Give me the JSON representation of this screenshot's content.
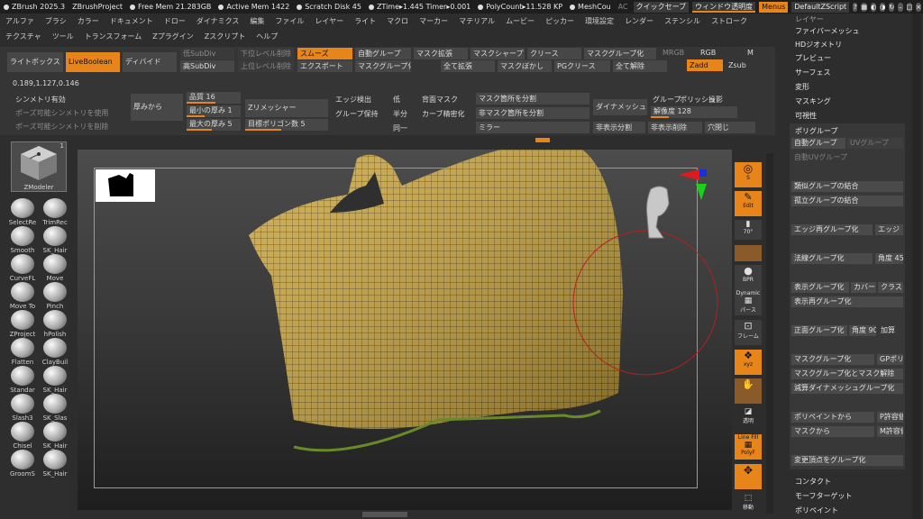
{
  "topbar": {
    "app": "ZBrush 2025.3",
    "project": "ZBrushProject",
    "free_mem": "Free Mem 21.283GB",
    "active_mem": "Active Mem 1422",
    "scratch": "Scratch Disk 45",
    "ztime": "ZTime▸1.445 Timer▸0.001",
    "polycount": "PolyCount▸11.528 KP",
    "meshcount": "MeshCou",
    "ac": "AC",
    "quicksave": "クイックセーブ",
    "window_transparency": "ウィンドウ透明度",
    "menus": "Menus",
    "default_script": "DefaultZScript"
  },
  "menus_row1": [
    "アルファ",
    "ブラシ",
    "カラー",
    "ドキュメント",
    "ドロー",
    "ダイナミクス",
    "編集",
    "ファイル",
    "レイヤー",
    "ライト",
    "マクロ",
    "マーカー",
    "マテリアル",
    "ムービー",
    "ピッカー",
    "環境設定",
    "レンダー",
    "ステンシル",
    "ストローク"
  ],
  "menus_row2": [
    "テクスチャ",
    "ツール",
    "トランスフォーム",
    "Zプラグイン",
    "Zスクリプト",
    "ヘルプ"
  ],
  "toolpanel": {
    "lightbox": "ライトボックス",
    "liveboolean": "LiveBoolean",
    "divide": "ディバイド",
    "low_subdiv": "低SubDiv",
    "high_subdiv": "高SubDiv",
    "lower_level_delete": "下位レベル削除",
    "upper_level_delete": "上位レベル削除",
    "smooth": "スムーズ",
    "export": "エクスポート",
    "auto_group": "自動グループ",
    "mask_group": "マスクグループ化",
    "mask_expand": "マスク拡張",
    "all_expand": "全て拡張",
    "mask_sharpen": "マスクシャープ",
    "mask_blur": "マスクぼかし",
    "crease": "クリース",
    "pg_crease": "PGクリース",
    "polygroup_it": "マスクグループ化",
    "all_uncrease": "全て解除",
    "mrgb": "MRGB",
    "rgb": "RGB",
    "m": "M",
    "zadd": "Zadd",
    "zsub": "Zsub",
    "coords": "0.189,1.127,0.146",
    "symmetry": "シンメトリ有効",
    "pose_symmetry_use": "ポーズ可能シンメトリを使用",
    "pose_symmetry_delete": "ポーズ可能シンメトリを削除",
    "thickness_from": "厚みから",
    "quality_label": "品質",
    "quality_value": "16",
    "min_thickness_label": "最小の厚み",
    "min_thickness_value": "1",
    "max_thickness_label": "最大の厚み",
    "max_thickness_value": "5",
    "zremesher": "Zリメッシャー",
    "target_poly_label": "目標ポリゴン数",
    "target_poly_value": "5",
    "edge_detect": "エッジ検出",
    "keep_groups": "グループ保持",
    "low": "低",
    "half": "半分",
    "same": "同一",
    "backface_mask": "背面マスク",
    "curve_refine": "カーブ精密化",
    "split_masked": "マスク箇所を分割",
    "split_unmasked": "非マスク箇所を分割",
    "mirror": "ミラー",
    "dynamesh": "ダイナメッシュ",
    "groups": "グループ",
    "polish": "ポリッシュ",
    "project": "投影",
    "resolution_label": "解像度",
    "resolution_value": "128",
    "hide_display": "非表示分割",
    "hide_delete": "非表示削除",
    "close_holes": "穴閉じ"
  },
  "left_tools": {
    "zmodeler": "ZModeler",
    "count": "1",
    "items": [
      "SelectRe",
      "TrimRec",
      "Smooth",
      "SK_Hair",
      "CurveFL",
      "Move",
      "Move To",
      "Pinch",
      "ZProject",
      "hPolish",
      "Flatten",
      "ClayBuil",
      "Standar",
      "SK_Hair",
      "Slash3",
      "SK_Slas",
      "Chisel",
      "SK_Hair",
      "GroomS",
      "SK_Hair"
    ]
  },
  "shelf": {
    "s": "S",
    "edit": "Edit",
    "view_label": "70°",
    "bpr": "BPR",
    "dynamic": "Dynamic",
    "perspective": "パース",
    "frame": "フレーム",
    "xyz": "xyz",
    "transparent": "透明",
    "line_fill": "Line Fill",
    "polyf": "PolyF",
    "move_label": "移動"
  },
  "sidepanel": {
    "layers": "レイヤー",
    "fibermesh": "ファイバーメッシュ",
    "hd_geometry": "HDジオメトリ",
    "preview": "プレビュー",
    "surface": "サーフェス",
    "deformation": "変形",
    "masking": "マスキング",
    "visibility": "可視性",
    "polygroups": "ポリグループ",
    "auto_groups": "自動グループ",
    "uv_groups": "UVグループ",
    "auto_uv": "自動UVグループ",
    "merge_similar": "類似グループの結合",
    "merge_isolated": "孤立グループの結合",
    "edge_regroup": "エッジ再グループ化",
    "edge_short": "エッジ",
    "normal_groups": "法線グループ化",
    "angle_label": "角度",
    "angle_value": "45",
    "display_groups": "表示グループ化",
    "coverage": "カバー",
    "cluster": "クラスタ",
    "display_regroup": "表示再グループ化",
    "front_group": "正面グループ化",
    "angle2_label": "角度",
    "angle2_value": "90",
    "add": "加算",
    "mask_group": "マスクグループ化",
    "gp_short": "GPポリ",
    "mask_group_clear": "マスクグループ化とマスク解除",
    "reduce_dynamesh": "減算ダイナメッシュグループ化",
    "from_polypaint": "ポリペイントから",
    "p_tolerance": "P許容値",
    "from_mask": "マスクから",
    "m_tolerance": "M許容値",
    "changed_vertex": "変更頂点をグループ化",
    "contact": "コンタクト",
    "morph_target": "モーフターゲット",
    "polypaint": "ポリペイント"
  },
  "colors": {
    "accent": "#e8851a",
    "mesh": "#c9a33a",
    "panel": "#353535"
  }
}
